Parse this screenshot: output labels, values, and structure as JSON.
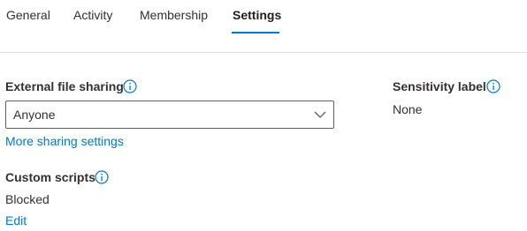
{
  "tabs": [
    {
      "label": "General"
    },
    {
      "label": "Activity"
    },
    {
      "label": "Membership"
    },
    {
      "label": "Settings",
      "active": true
    }
  ],
  "external_sharing": {
    "label": "External file sharing",
    "selected": "Anyone",
    "more_link": "More sharing settings"
  },
  "sensitivity": {
    "label": "Sensitivity label",
    "value": "None"
  },
  "custom_scripts": {
    "label": "Custom scripts",
    "value": "Blocked",
    "edit_link": "Edit"
  },
  "colors": {
    "accent": "#0078d4",
    "text": "#323130",
    "divider": "#e1dfdd"
  },
  "icons": {
    "info": "info-circle-icon",
    "dropdown": "chevron-down-icon"
  }
}
